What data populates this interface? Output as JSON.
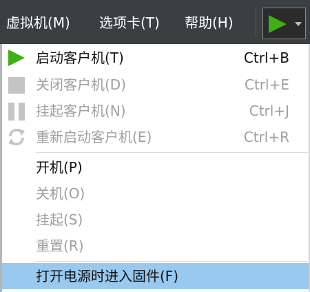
{
  "menubar": {
    "vm_menu": "虚拟机(M)",
    "tab_menu": "选项卡(T)",
    "help_menu": "帮助(H)",
    "play_button_icon": "play-icon",
    "dropdown_arrow_icon": "chevron-down-icon"
  },
  "colors": {
    "menubar_bg": "#3c3f41",
    "play_green": "#3cb015",
    "highlight": "#99c9ef",
    "disabled_text": "#9e9e9e"
  },
  "menu_items": [
    {
      "label": "启动客户机(T)",
      "shortcut": "Ctrl+B",
      "icon": "play-icon",
      "enabled": true
    },
    {
      "label": "关闭客户机(D)",
      "shortcut": "Ctrl+E",
      "icon": "stop-icon",
      "enabled": false
    },
    {
      "label": "挂起客户机(N)",
      "shortcut": "Ctrl+J",
      "icon": "pause-icon",
      "enabled": false
    },
    {
      "label": "重新启动客户机(E)",
      "shortcut": "Ctrl+R",
      "icon": "restart-icon",
      "enabled": false
    },
    {
      "label": "开机(P)",
      "enabled": true
    },
    {
      "label": "关机(O)",
      "enabled": false
    },
    {
      "label": "挂起(S)",
      "enabled": false
    },
    {
      "label": "重置(R)",
      "enabled": false
    },
    {
      "label": "打开电源时进入固件(F)",
      "enabled": true,
      "highlighted": true
    }
  ]
}
